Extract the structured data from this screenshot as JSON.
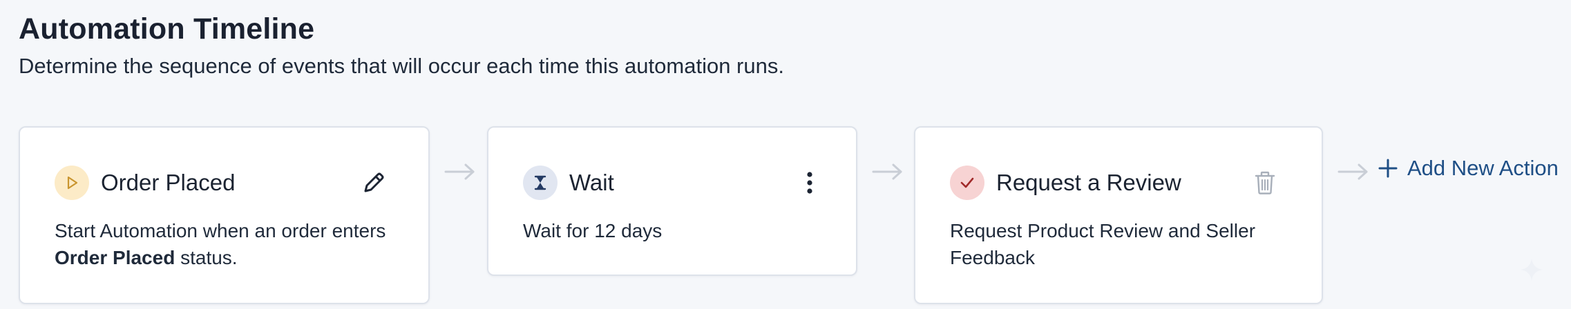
{
  "header": {
    "title": "Automation Timeline",
    "subtitle": "Determine the sequence of events that will occur each time this automation runs."
  },
  "steps": [
    {
      "title": "Order Placed",
      "icon": "play-icon",
      "action_icon": "pencil-icon",
      "description_prefix": "Start Automation when an order enters ",
      "description_bold": "Order Placed",
      "description_suffix": " status.",
      "badge_color": "#fcebc7",
      "icon_color": "#c9952f"
    },
    {
      "title": "Wait",
      "icon": "hourglass-icon",
      "action_icon": "more-vertical-icon",
      "description": "Wait for 12 days",
      "badge_color": "#e1e6f1",
      "icon_color": "#243a63"
    },
    {
      "title": "Request a Review",
      "icon": "check-icon",
      "action_icon": "trash-icon",
      "description": "Request Product Review and Seller Feedback",
      "badge_color": "#f7d3d3",
      "icon_color": "#a12a2a"
    }
  ],
  "add_action": {
    "label": "Add New Action",
    "icon": "plus-icon",
    "color": "#1f4f86"
  }
}
